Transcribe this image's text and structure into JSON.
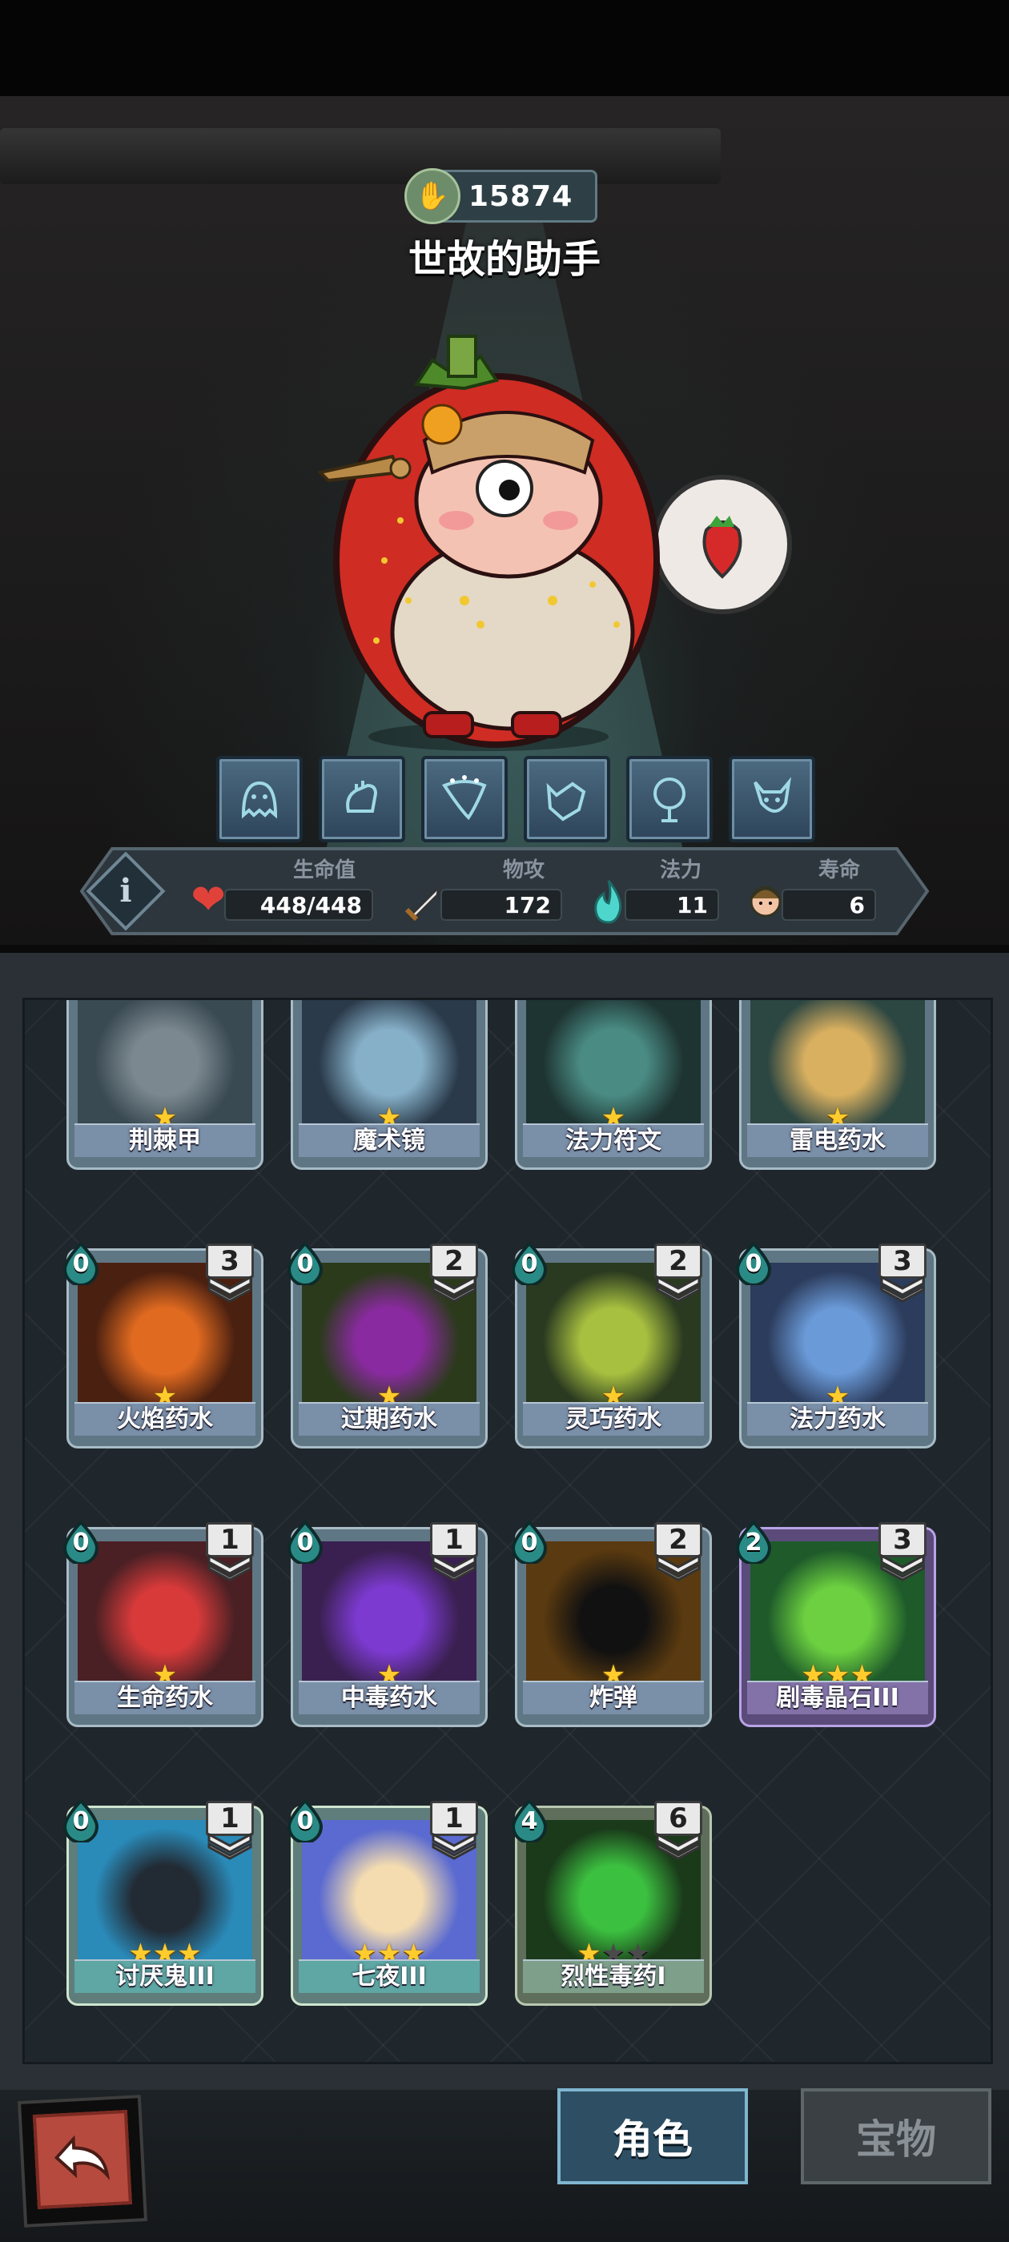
{
  "header": {
    "score": "15874",
    "score_icon": "skull-hand-icon",
    "character_name": "世故的助手"
  },
  "skills": [
    {
      "icon": "ghost-icon"
    },
    {
      "icon": "fist-icon"
    },
    {
      "icon": "scarf-icon"
    },
    {
      "icon": "wolf-icon"
    },
    {
      "icon": "tree-icon"
    },
    {
      "icon": "demon-head-icon"
    }
  ],
  "stats": {
    "hp_label": "生命值",
    "hp_value": "448/448",
    "atk_label": "物攻",
    "atk_value": "172",
    "mana_label": "法力",
    "mana_value": "11",
    "life_label": "寿命",
    "life_value": "6"
  },
  "cards": [
    {
      "name": "荆棘甲",
      "stars": 1,
      "max_stars": 1,
      "partial": true
    },
    {
      "name": "魔术镜",
      "stars": 1,
      "max_stars": 1,
      "partial": true
    },
    {
      "name": "法力符文",
      "stars": 1,
      "max_stars": 1,
      "partial": true
    },
    {
      "name": "雷电药水",
      "stars": 1,
      "max_stars": 1,
      "partial": true
    },
    {
      "name": "火焰药水",
      "cost": "0",
      "level": "3",
      "stars": 1,
      "max_stars": 1
    },
    {
      "name": "过期药水",
      "cost": "0",
      "level": "2",
      "stars": 1,
      "max_stars": 1
    },
    {
      "name": "灵巧药水",
      "cost": "0",
      "level": "2",
      "stars": 1,
      "max_stars": 1
    },
    {
      "name": "法力药水",
      "cost": "0",
      "level": "3",
      "stars": 1,
      "max_stars": 1
    },
    {
      "name": "生命药水",
      "cost": "0",
      "level": "1",
      "stars": 1,
      "max_stars": 1
    },
    {
      "name": "中毒药水",
      "cost": "0",
      "level": "1",
      "stars": 1,
      "max_stars": 1
    },
    {
      "name": "炸弹",
      "cost": "0",
      "level": "2",
      "stars": 1,
      "max_stars": 1
    },
    {
      "name": "剧毒晶石III",
      "cost": "2",
      "level": "3",
      "stars": 3,
      "max_stars": 3
    },
    {
      "name": "讨厌鬼III",
      "cost": "0",
      "level": "1",
      "stars": 3,
      "max_stars": 3
    },
    {
      "name": "七夜III",
      "cost": "0",
      "level": "1",
      "stars": 3,
      "max_stars": 3
    },
    {
      "name": "烈性毒药I",
      "cost": "4",
      "level": "6",
      "stars": 1,
      "max_stars": 3
    }
  ],
  "tabs": {
    "role": "角色",
    "treasure": "宝物"
  },
  "colors": {
    "accent_teal": "#5fd0c8",
    "star_gold": "#ffcc2e",
    "back_red": "#b64a3f"
  }
}
